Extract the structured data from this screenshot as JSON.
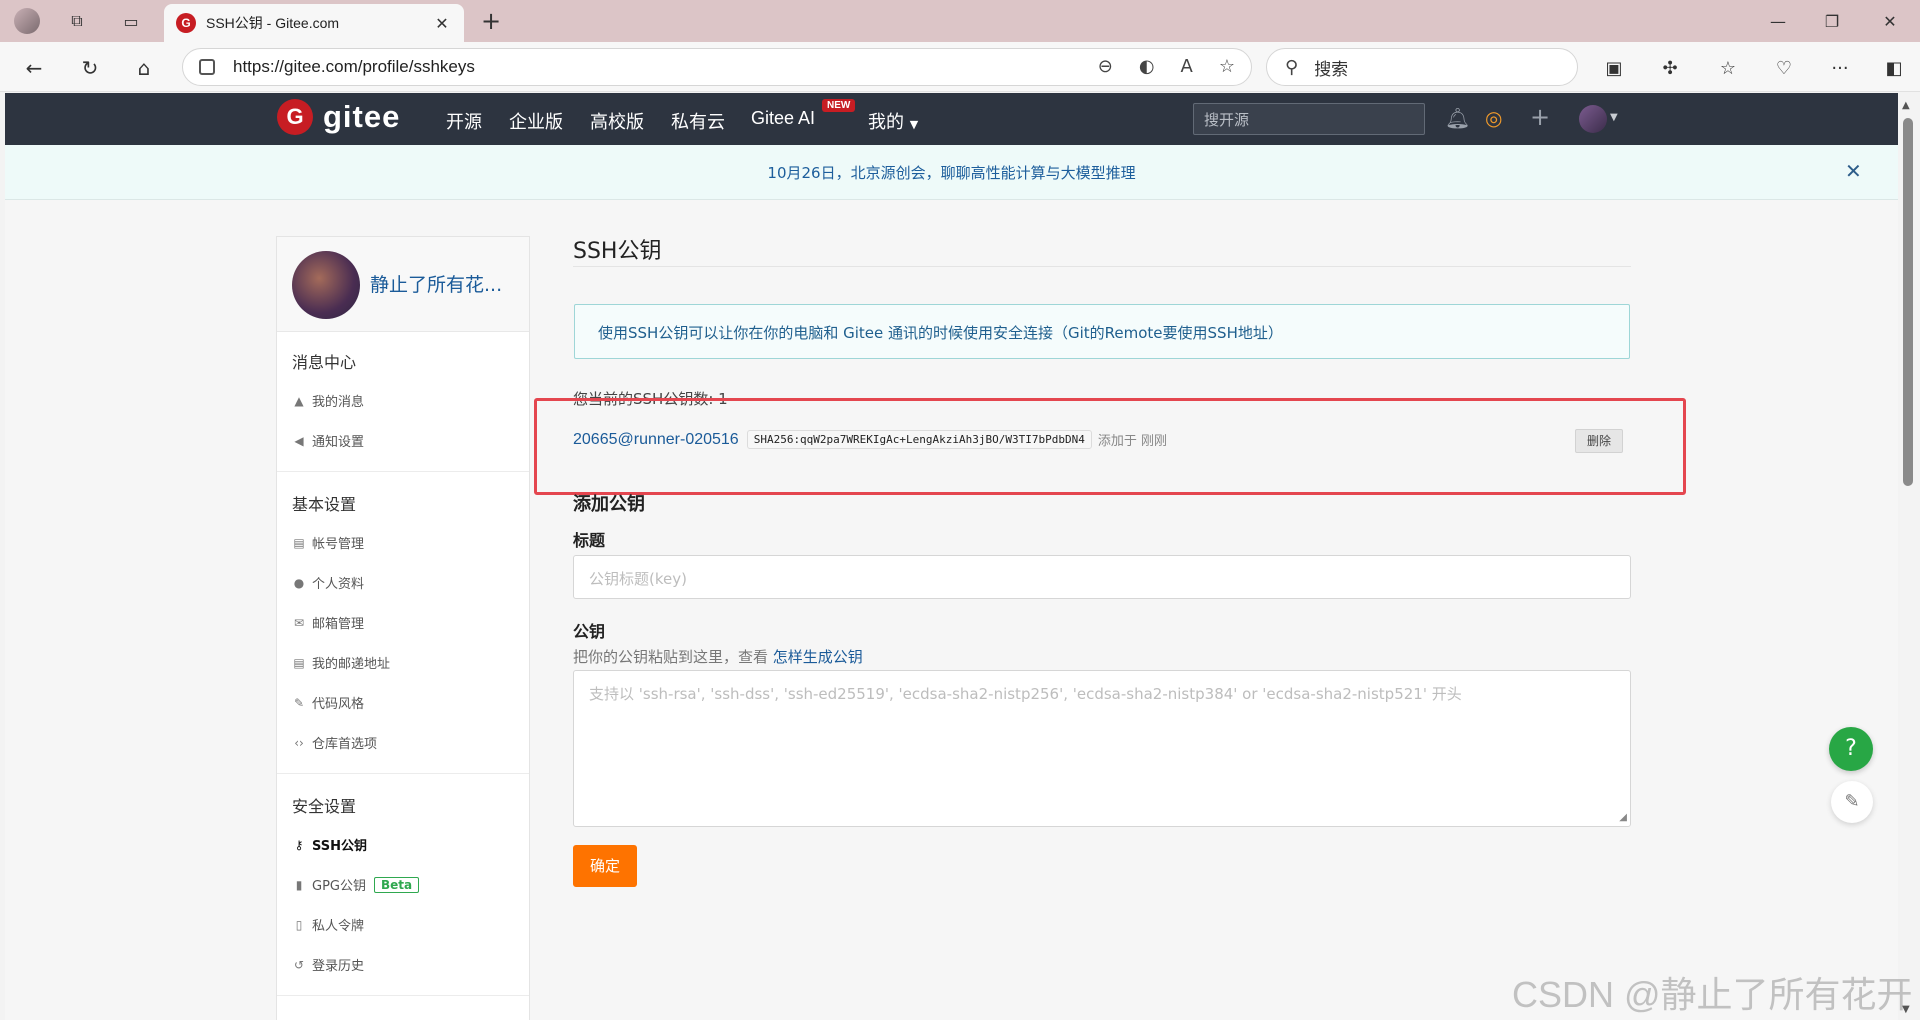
{
  "browser": {
    "tab_title": "SSH公钥 - Gitee.com",
    "url": "https://gitee.com/profile/sshkeys",
    "search_placeholder": "搜索"
  },
  "gitee_nav": {
    "logo_text": "gitee",
    "items": [
      "开源",
      "企业版",
      "高校版",
      "私有云",
      "Gitee AI",
      "我的"
    ],
    "new_badge": "NEW",
    "search_placeholder": "搜开源"
  },
  "banner": {
    "text": "10月26日，北京源创会，聊聊高性能计算与大模型推理"
  },
  "sidebar": {
    "user_name": "静止了所有花...",
    "sections": [
      {
        "title": "消息中心",
        "items": [
          "我的消息",
          "通知设置"
        ]
      },
      {
        "title": "基本设置",
        "items": [
          "帐号管理",
          "个人资料",
          "邮箱管理",
          "我的邮递地址",
          "代码风格",
          "仓库首选项"
        ]
      },
      {
        "title": "安全设置",
        "items": [
          "SSH公钥",
          "GPG公钥",
          "私人令牌",
          "登录历史"
        ]
      }
    ],
    "beta_label": "Beta"
  },
  "main": {
    "title": "SSH公钥",
    "info": "使用SSH公钥可以让你在你的电脑和 Gitee 通讯的时候使用安全连接（Git的Remote要使用SSH地址）",
    "count_line": "您当前的SSH公钥数: 1",
    "key": {
      "name": "20665@runner-020516",
      "fingerprint": "SHA256:qqW2pa7WREKIgAc+LengAkziAh3jBO/W3TI7bPdbDN4",
      "added": "添加于 刚刚",
      "delete_label": "删除"
    },
    "add_title": "添加公钥",
    "title_label": "标题",
    "title_placeholder": "公钥标题(key)",
    "key_label": "公钥",
    "key_hint": "把你的公钥粘贴到这里，查看 ",
    "key_hint_link": "怎样生成公钥",
    "key_placeholder": "支持以 'ssh-rsa', 'ssh-dss', 'ssh-ed25519', 'ecdsa-sha2-nistp256', 'ecdsa-sha2-nistp384' or 'ecdsa-sha2-nistp521' 开头",
    "submit_label": "确定"
  },
  "floating": {
    "help": "?"
  },
  "watermark": "CSDN @静止了所有花开"
}
